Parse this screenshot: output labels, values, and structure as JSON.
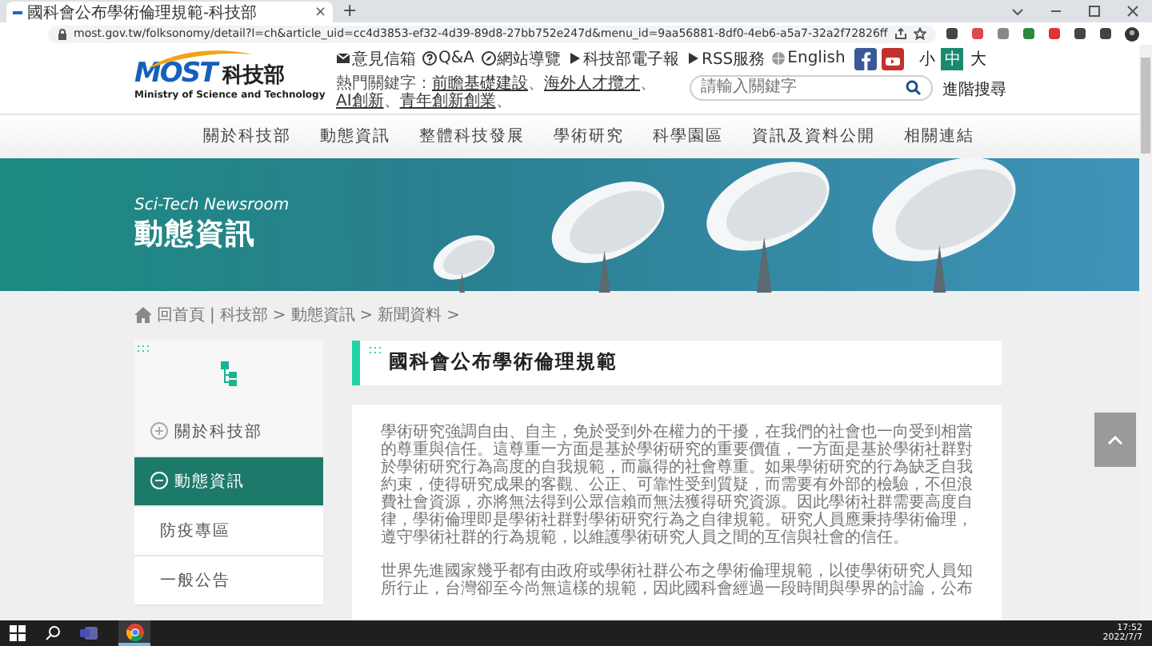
{
  "browser": {
    "tab_title": "國科會公布學術倫理規範-科技部",
    "tab_close": "×",
    "new_tab": "+",
    "url": "most.gov.tw/folksonomy/detail?l=ch&article_uid=cc4d3853-ef32-4d39-89d8-27bb752e247d&menu_id=9aa56881-8df0-4eb6-a5a7-32a2f72826ff"
  },
  "logo": {
    "mark": "MOST",
    "name": "科技部",
    "english": "Ministry of Science and Technology"
  },
  "top_links": [
    {
      "kind": "mail",
      "label": "意見信箱"
    },
    {
      "kind": "qa",
      "label": "Q&A"
    },
    {
      "kind": "compass",
      "label": "網站導覽"
    },
    {
      "kind": "play",
      "label": "科技部電子報"
    },
    {
      "kind": "play",
      "label": "RSS服務"
    },
    {
      "kind": "globe",
      "label": "English"
    }
  ],
  "font_sizes": [
    {
      "label": "小",
      "selected": false
    },
    {
      "label": "中",
      "selected": true
    },
    {
      "label": "大",
      "selected": false
    }
  ],
  "keywords": {
    "label": "熱門關鍵字：",
    "items": [
      {
        "text": "前瞻基礎建設",
        "sep": "、"
      },
      {
        "text": "海外人才攬才",
        "sep": "、"
      },
      {
        "text": "AI創新",
        "sep": "、"
      },
      {
        "text": "青年創新創業",
        "sep": "、"
      }
    ]
  },
  "search": {
    "placeholder": "請輸入關鍵字",
    "advanced": "進階搜尋"
  },
  "nav": [
    "關於科技部",
    "動態資訊",
    "整體科技發展",
    "學術研究",
    "科學園區",
    "資訊及資料公開",
    "相關連結"
  ],
  "banner": {
    "subtitle": "Sci-Tech Newsroom",
    "title": "動態資訊"
  },
  "breadcrumb": [
    {
      "label": "回首頁",
      "sep": "|"
    },
    {
      "label": "科技部",
      "sep": ">"
    },
    {
      "label": "動態資訊",
      "sep": ">"
    },
    {
      "label": "新聞資料",
      "sep": ">"
    }
  ],
  "sidebar": [
    {
      "kind": "group",
      "label": "關於科技部",
      "expanded": false,
      "selected": false
    },
    {
      "kind": "group",
      "label": "動態資訊",
      "expanded": true,
      "selected": true
    },
    {
      "kind": "sub",
      "label": "防疫專區",
      "selected": false
    },
    {
      "kind": "sub",
      "label": "一般公告",
      "selected": false
    }
  ],
  "article": {
    "title": "國科會公布學術倫理規範",
    "paragraphs": [
      "學術研究強調自由、自主，免於受到外在權力的干擾，在我們的社會也一向受到相當的尊重與信任。這尊重一方面是基於學術研究的重要價值，一方面是基於學術社群對於學術研究行為高度的自我規範，而贏得的社會尊重。如果學術研究的行為缺乏自我約束，使得研究成果的客觀、公正、可靠性受到質疑，而需要有外部的檢驗，不但浪費社會資源，亦將無法得到公眾信賴而無法獲得研究資源。因此學術社群需要高度自律，學術倫理即是學術社群對學術研究行為之自律規範。研究人員應秉持學術倫理，遵守學術社群的行為規範，以維護學術研究人員之間的互信與社會的信任。",
      "世界先進國家幾乎都有由政府或學術社群公布之學術倫理規範，以使學術研究人員知所行止，台灣卻至今尚無這樣的規範，因此國科會經過一段時間與學界的討論，公布"
    ]
  },
  "taskbar": {
    "time": "17:52",
    "date": "2022/7/7"
  }
}
